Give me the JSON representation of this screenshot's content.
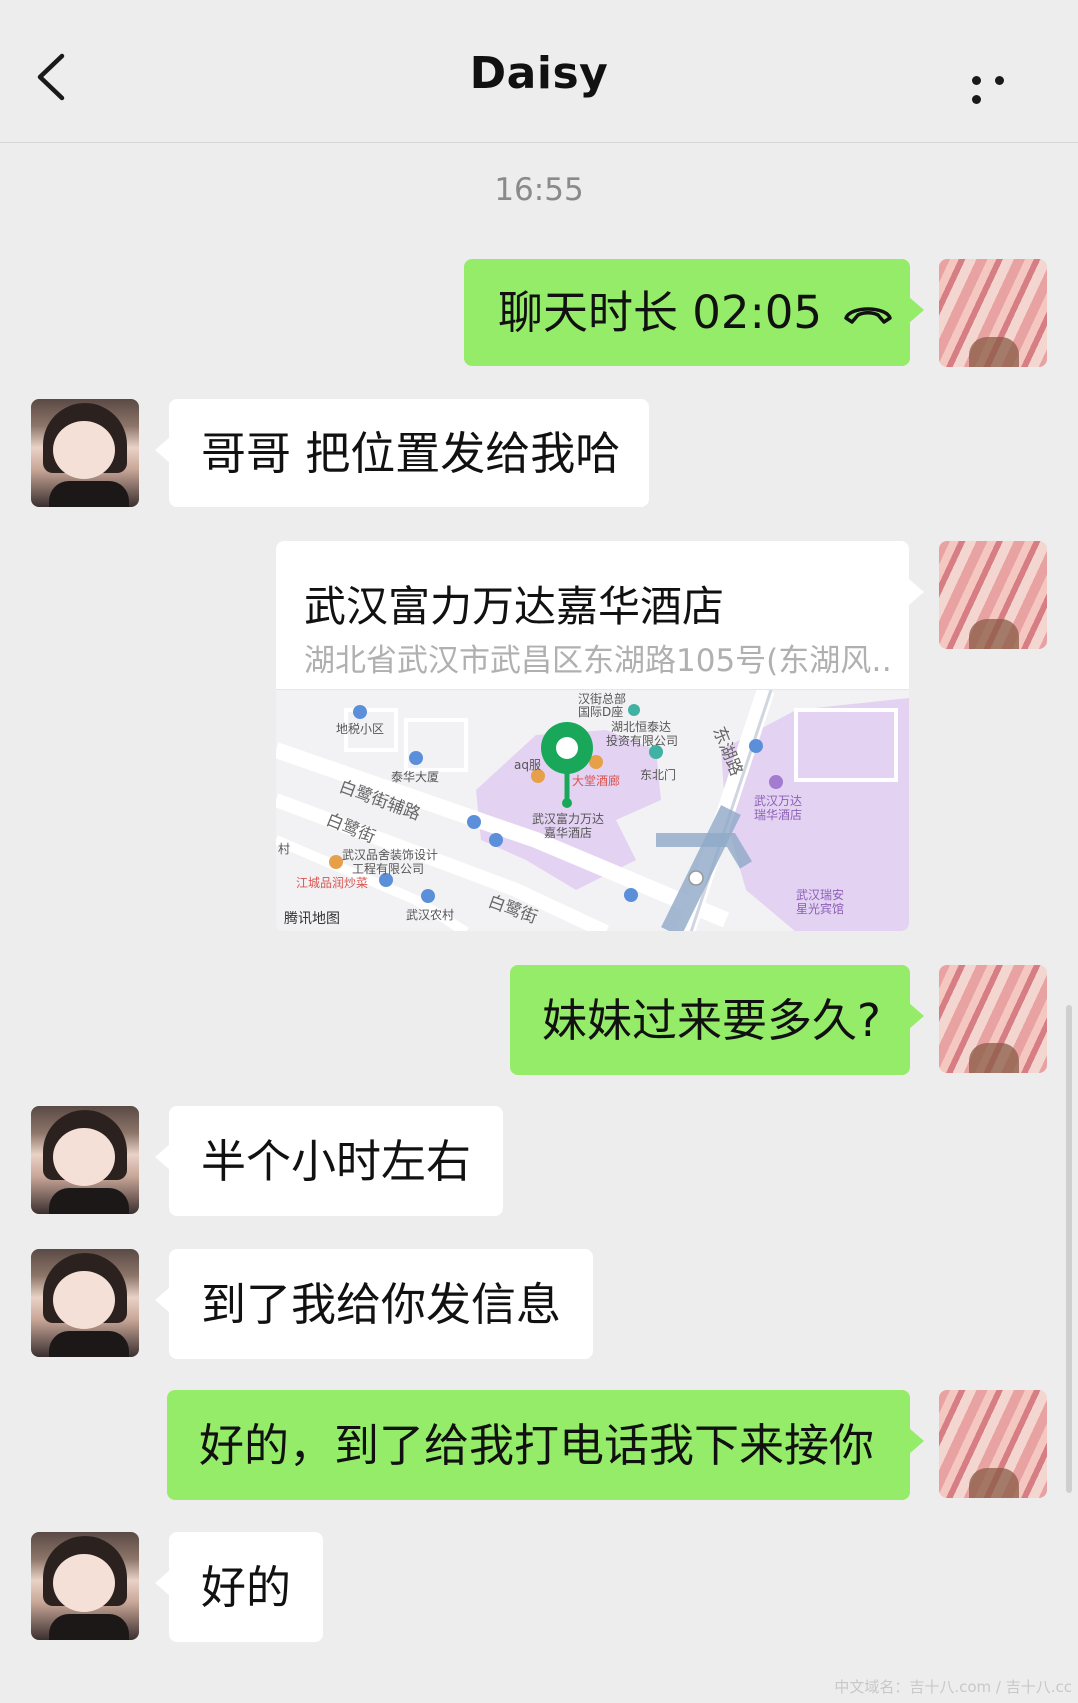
{
  "header": {
    "title": "Daisy",
    "back_icon": "chevron-left-icon",
    "more_icon": "more-dots-icon"
  },
  "timestamp": "16:55",
  "messages": [
    {
      "side": "right",
      "type": "call",
      "text": "聊天时长 02:05",
      "icon": "phone-hangup-icon"
    },
    {
      "side": "left",
      "type": "text",
      "text": "哥哥 把位置发给我哈"
    },
    {
      "side": "right",
      "type": "location",
      "name": "武汉富力万达嘉华酒店",
      "address": "湖北省武汉市武昌区东湖路105号(东湖风…",
      "map_labels": {
        "a": "汉街总部",
        "b": "国际D座",
        "c": "湖北恒泰达",
        "d": "投资有限公司",
        "e": "地税小区",
        "f": "泰华大厦",
        "g": "aq服",
        "h": "大堂酒廊",
        "i": "东北门",
        "j": "武汉富力万达",
        "k": "嘉华酒店",
        "l": "武汉万达",
        "m": "瑞华酒店",
        "n": "武汉品舍装饰设计",
        "o": "工程有限公司",
        "p": "江城品润炒菜",
        "q": "武汉瑞安",
        "r": "星光宾馆",
        "s": "武汉农村",
        "t": "村",
        "road1": "白鹭街辅路",
        "road2": "白鹭街",
        "road3": "白鹭街",
        "road4": "东湖路"
      },
      "map_brand": "腾讯地图"
    },
    {
      "side": "right",
      "type": "text",
      "text": "妹妹过来要多久?"
    },
    {
      "side": "left",
      "type": "text",
      "text": "半个小时左右"
    },
    {
      "side": "left",
      "type": "text",
      "text": "到了我给你发信息"
    },
    {
      "side": "right",
      "type": "text",
      "text": "好的，到了给我打电话我下来接你"
    },
    {
      "side": "left",
      "type": "text",
      "text": "好的"
    }
  ],
  "watermark": "中文域名：吉十八.com / 吉十八.cc",
  "colors": {
    "background": "#ededed",
    "sent_bubble": "#95ec69",
    "received_bubble": "#ffffff",
    "timestamp": "#8a8a8a"
  }
}
